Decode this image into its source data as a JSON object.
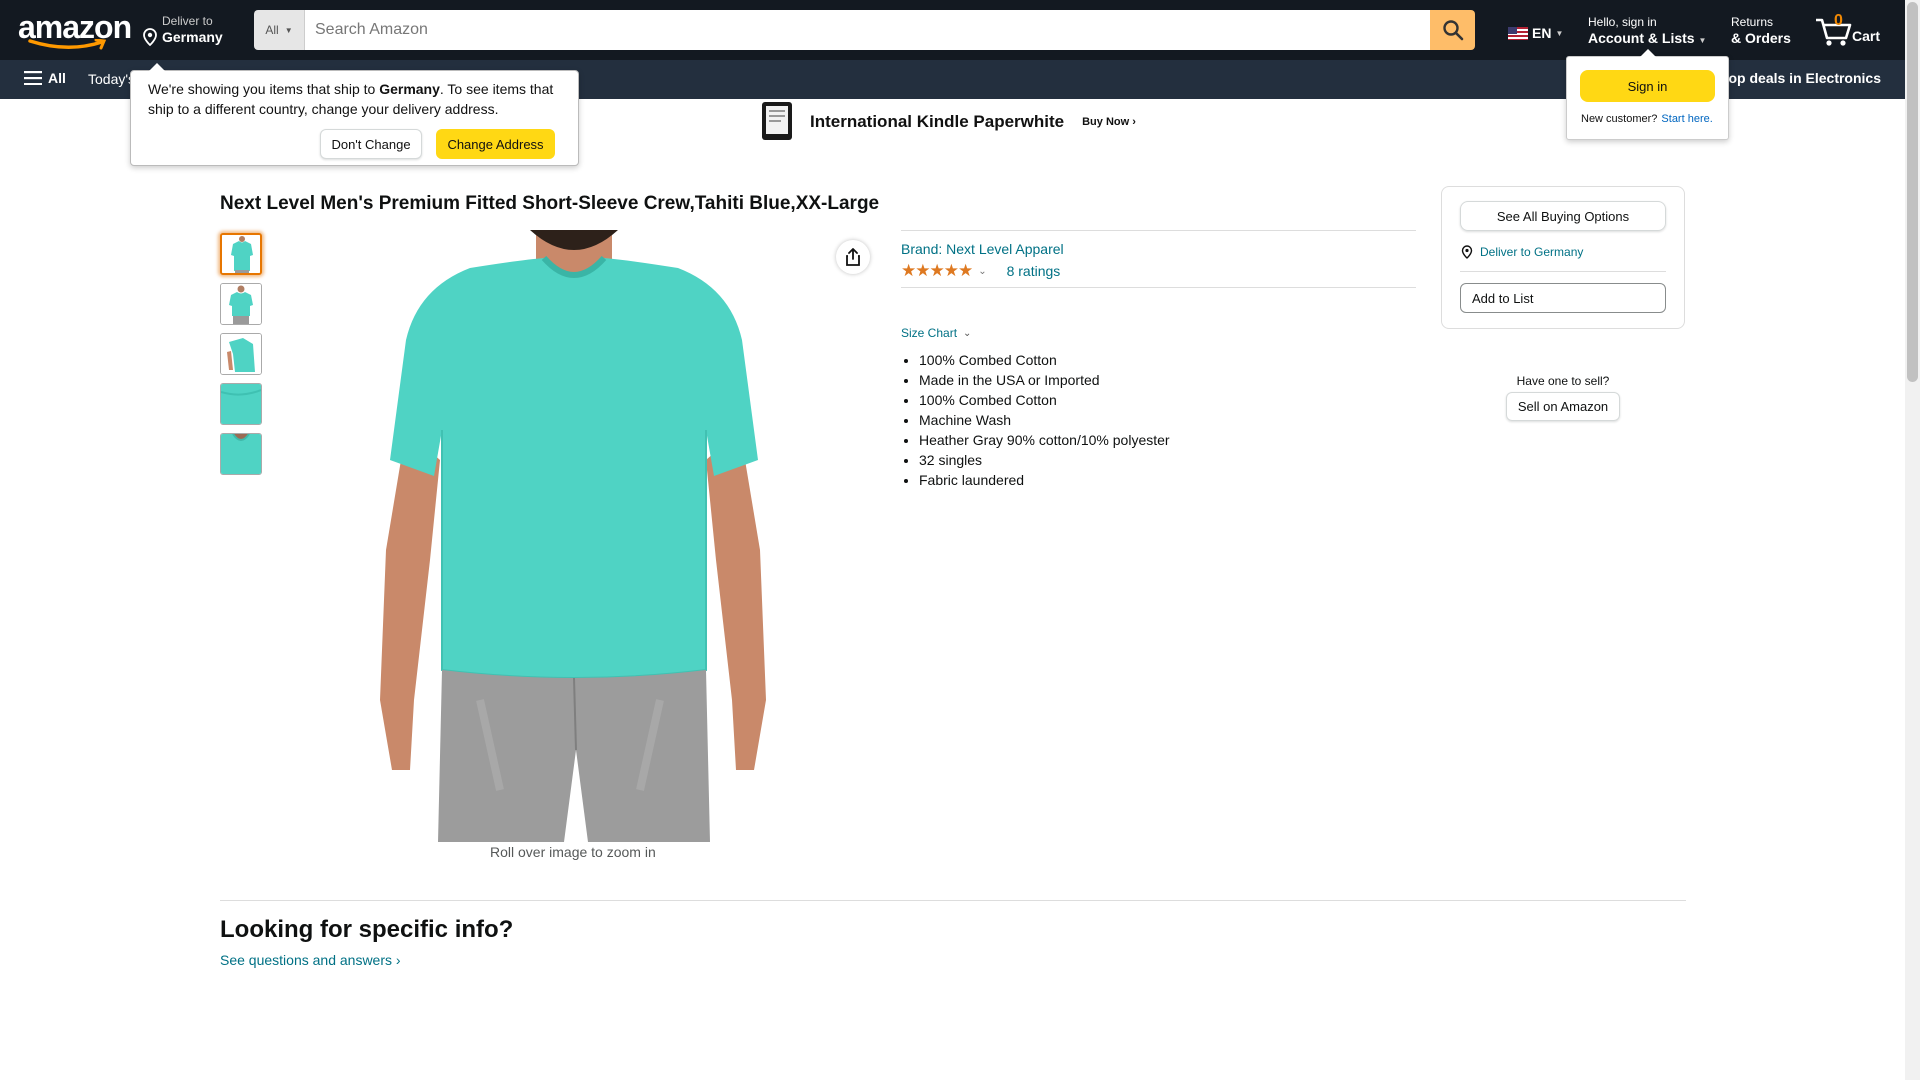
{
  "header": {
    "deliver_line1": "Deliver to",
    "deliver_line2": "Germany",
    "search_category": "All",
    "search_placeholder": "Search Amazon",
    "language": "EN",
    "account_line1": "Hello, sign in",
    "account_line2": "Account & Lists",
    "returns_line1": "Returns",
    "returns_line2": "& Orders",
    "cart_count": "0",
    "cart_label": "Cart"
  },
  "subnav": {
    "all_label": "All",
    "today_label": "Today's",
    "deals_label": "op deals in Electronics"
  },
  "banner": {
    "title": "International Kindle Paperwhite",
    "cta": "Buy Now ›"
  },
  "ship_popover": {
    "text_before": "We're showing you items that ship to ",
    "country": "Germany",
    "text_after": ". To see items that ship to a different country, change your delivery address.",
    "dont_change": "Don't Change",
    "change_address": "Change Address"
  },
  "signin_flyout": {
    "button": "Sign in",
    "new_customer": "New customer?",
    "start_here": "Start here."
  },
  "product": {
    "title": "Next Level Men's Premium Fitted Short-Sleeve Crew,Tahiti Blue,XX-Large",
    "brand": "Brand: Next Level Apparel",
    "rating_stars": 5,
    "ratings_count": "8 ratings",
    "size_chart": "Size Chart",
    "zoom_hint": "Roll over image to zoom in",
    "bullets": [
      "100% Combed Cotton",
      "Made in the USA or Imported",
      "100% Combed Cotton",
      "Machine Wash",
      "Heather Gray 90% cotton/10% polyester",
      "32 singles",
      "Fabric laundered"
    ],
    "shirt_color": "#4fd3c4"
  },
  "buybox": {
    "see_all": "See All Buying Options",
    "deliver": "Deliver to Germany",
    "add_to_list": "Add to List",
    "sell_question": "Have one to sell?",
    "sell_button": "Sell on Amazon"
  },
  "info_section": {
    "title": "Looking for specific info?",
    "link": "See questions and answers ›"
  }
}
